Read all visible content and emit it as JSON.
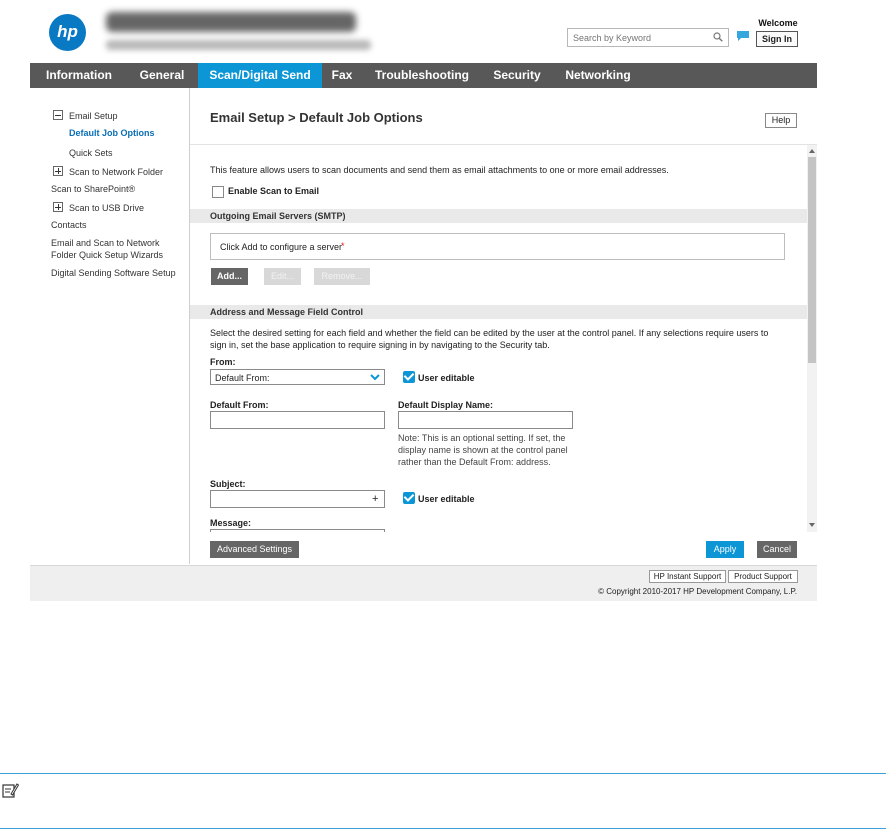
{
  "header": {
    "logo_text": "hp",
    "search_placeholder": "Search by Keyword",
    "welcome": "Welcome",
    "sign_in": "Sign In"
  },
  "nav": {
    "tabs": [
      {
        "label": "Information"
      },
      {
        "label": "General"
      },
      {
        "label": "Scan/Digital Send",
        "active": true
      },
      {
        "label": "Fax"
      },
      {
        "label": "Troubleshooting"
      },
      {
        "label": "Security"
      },
      {
        "label": "Networking"
      }
    ]
  },
  "sidebar": {
    "items": [
      {
        "label": "Email Setup",
        "toggle": "minus"
      },
      {
        "label": "Default Job Options",
        "active": true
      },
      {
        "label": "Quick Sets"
      },
      {
        "label": "Scan to Network Folder",
        "toggle": "plus"
      },
      {
        "label": "Scan to SharePoint®"
      },
      {
        "label": "Scan to USB Drive",
        "toggle": "plus"
      },
      {
        "label": "Contacts"
      },
      {
        "label": "Email and Scan to Network"
      },
      {
        "label": "Folder Quick Setup Wizards"
      },
      {
        "label": "Digital Sending Software Setup"
      }
    ]
  },
  "main": {
    "title": "Email Setup > Default Job Options",
    "help": "Help",
    "intro": "This feature allows users to scan documents and send them as email attachments to one or more email addresses.",
    "enable_label": "Enable Scan to Email",
    "smtp_section": "Outgoing Email Servers (SMTP)",
    "smtp_placeholder": "Click Add to configure a server",
    "required_mark": "*",
    "add_button": "Add...",
    "edit_button": "Edit...",
    "remove_button": "Remove...",
    "address_section": "Address and Message Field Control",
    "address_desc_1": "Select the desired setting for each field and whether the field can be edited by the user at the control panel. If any selections require users to",
    "address_desc_2": "sign in, set the base application to require signing in by navigating to the Security tab.",
    "from_label": "From:",
    "from_value": "Default From:",
    "user_editable": "User editable",
    "default_from_label": "Default From:",
    "default_display_name_label": "Default Display Name:",
    "note_1": "Note: This is an optional setting. If set, the",
    "note_2": "display name is shown at the control panel",
    "note_3": "rather than the Default From: address.",
    "subject_label": "Subject:",
    "plus": "+",
    "message_label": "Message:",
    "advanced_button": "Advanced Settings",
    "apply_button": "Apply",
    "cancel_button": "Cancel"
  },
  "footer": {
    "instant_support": "HP Instant Support",
    "product_support": "Product Support",
    "copyright": "© Copyright 2010-2017 HP Development Company, L.P."
  },
  "colors": {
    "nav_bg": "#585858",
    "active_tab": "#0d96d6",
    "accent": "#0d96d6",
    "hp_blue": "#0a79c4"
  }
}
